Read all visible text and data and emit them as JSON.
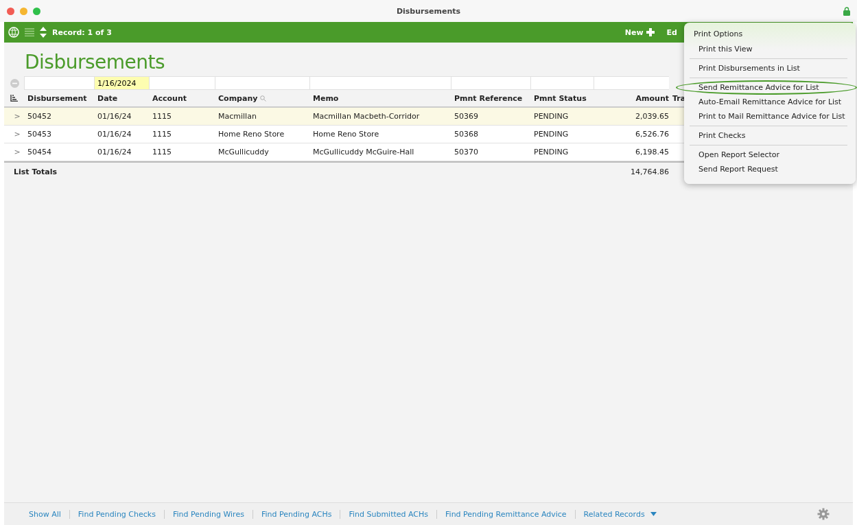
{
  "window": {
    "title": "Disbursements"
  },
  "toolbar": {
    "record": "Record: 1 of 3",
    "new_label": "New",
    "edit_label": "Ed"
  },
  "page_title": "Disbursements",
  "filters": [
    {
      "active": false
    },
    {
      "value": "1/16/2024",
      "active": true
    },
    {
      "active": false
    },
    {
      "active": false
    },
    {
      "active": false
    },
    {
      "active": false
    },
    {
      "active": false
    },
    {
      "active": false
    }
  ],
  "table": {
    "columns": [
      "Disbursement",
      "Date",
      "Account",
      "Company",
      "Memo",
      "Pmnt Reference",
      "Pmnt Status",
      "Amount",
      "Tra"
    ],
    "rows": [
      {
        "selected": true,
        "expander": ">",
        "cells": [
          "50452",
          "01/16/24",
          "1115",
          "Macmillan",
          "Macmillan Macbeth-Corridor",
          "50369",
          "PENDING",
          "2,039.65"
        ]
      },
      {
        "selected": false,
        "expander": ">",
        "cells": [
          "50453",
          "01/16/24",
          "1115",
          "Home Reno Store",
          "Home Reno Store",
          "50368",
          "PENDING",
          "6,526.76"
        ]
      },
      {
        "selected": false,
        "expander": ">",
        "cells": [
          "50454",
          "01/16/24",
          "1115",
          "McGullicuddy",
          "McGullicuddy McGuire-Hall",
          "50370",
          "PENDING",
          "6,198.45"
        ]
      }
    ],
    "totals_label": "List Totals",
    "total_amount": "14,764.86"
  },
  "menu": {
    "title": "Print Options",
    "groups": [
      [
        {
          "label": "Print this View",
          "circled": false
        }
      ],
      [
        {
          "label": "Print Disbursements in List",
          "circled": false
        }
      ],
      [
        {
          "label": "Send Remittance Advice for List",
          "circled": true
        },
        {
          "label": "Auto-Email Remittance Advice for List",
          "circled": false
        },
        {
          "label": "Print to Mail Remittance Advice for List",
          "circled": false
        }
      ],
      [
        {
          "label": "Print Checks",
          "circled": false
        }
      ],
      [
        {
          "label": "Open Report Selector",
          "circled": false
        },
        {
          "label": "Send Report Request",
          "circled": false
        }
      ]
    ]
  },
  "footer": {
    "links": [
      "Show All",
      "Find Pending Checks",
      "Find Pending Wires",
      "Find Pending ACHs",
      "Find Submitted ACHs",
      "Find Pending Remittance Advice"
    ],
    "dropdown": "Related Records"
  }
}
